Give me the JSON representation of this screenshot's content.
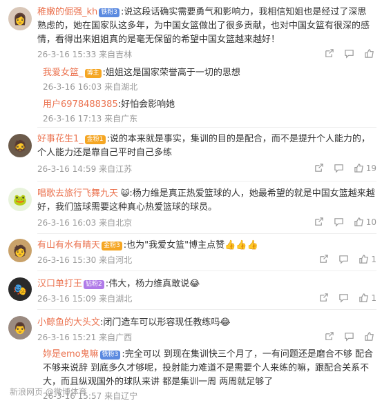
{
  "comments": [
    {
      "avatar_emoji": "👩",
      "avatar_bg": "#d9c7b8",
      "user": "稚嫩的倔强_kh",
      "badge": "铁粉3",
      "badge_color": "blue",
      "text": ":说这段话确实需要勇气和影响力，我相信知姐也是经过了深思熟虑的，她在国家队这多年，为中国女篮做出了很多贡献，也对中国女篮有很深的感情，看得出来姐姐真的是毫无保留的希望中国女篮越来越好！",
      "time": "26-3-16 15:33",
      "location": "来自吉林",
      "likes": "",
      "replies": [
        {
          "user": "我爱女篮_",
          "badge": "博主",
          "text": ":姐姐这是国家荣誉高于一切的思想",
          "time": "26-3-16 16:03",
          "location": "来自湖北"
        },
        {
          "user": "用户6978488385",
          "badge": "",
          "text": ":好怕会影响她",
          "time": "26-3-16 17:13",
          "location": "来自广东"
        }
      ]
    },
    {
      "avatar_emoji": "🧔",
      "avatar_bg": "#6b5a4a",
      "user": "好事花生1_",
      "badge": "金粉1",
      "badge_color": "orange",
      "text": ":说的本来就是事实，集训的目的是配合，而不是提升个人能力的，个人能力还是靠自己平时自己多练",
      "time": "26-3-16 14:59",
      "location": "来自江苏",
      "likes": "19"
    },
    {
      "avatar_emoji": "🐸",
      "avatar_bg": "#e8f3dc",
      "user": "唱歌去旅行飞舞九天",
      "badge": "",
      "badge_color": "",
      "text": ":杨力维是真正热爱篮球的人，她最希望的就是中国女篮越来越好，我们篮球需要这种真心热爱篮球的球员。",
      "time": "26-3-16 16:03",
      "location": "来自北京",
      "likes": "10"
    },
    {
      "avatar_emoji": "🧑",
      "avatar_bg": "#c9a26a",
      "user": "有山有水有晴天",
      "badge": "金粉3",
      "badge_color": "orange",
      "text": ":也为\"我爱女篮\"博主点赞👍👍👍",
      "time": "26-3-16 15:30",
      "location": "来自河北",
      "likes": "1"
    },
    {
      "avatar_emoji": "🎭",
      "avatar_bg": "#2a2a2a",
      "user": "汉口单打王",
      "badge": "钻粉2",
      "badge_color": "purple",
      "text": ":伟大，杨力维真敢说😂",
      "time": "26-3-16 15:09",
      "location": "来自湖北",
      "likes": "1"
    },
    {
      "avatar_emoji": "👨",
      "avatar_bg": "#9a8a80",
      "user": "小鲸鱼的大头文",
      "badge": "",
      "badge_color": "",
      "text": ":闭门造车可以形容现任教练吗😂",
      "time": "26-3-16 15:21",
      "location": "来自广西",
      "likes": "",
      "replies": [
        {
          "user": "妳是emo鬼嘛",
          "badge": "铁粉3",
          "text": ":完全可以 到现在集训快三个月了，一有问题还是磨合不够 配合不够来说辞 到底多久才够呢，投射能力难道不是需要个人来练的嘛，跟配合关系不大，而且纵观国外的球队来讲 都是集训一周 两周就足够了",
          "time": "26-3-16 15:57",
          "location": "来自辽宁"
        }
      ]
    }
  ],
  "watermark": "新浪网页 @微博体育"
}
